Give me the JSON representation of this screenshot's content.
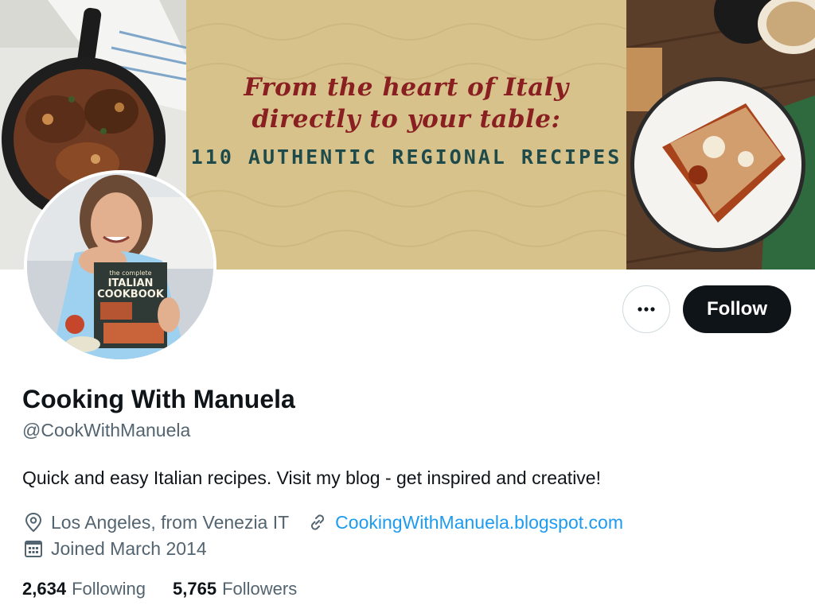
{
  "banner": {
    "line1": "From the heart of Italy",
    "line2": "directly to your table:",
    "line3": "110 AUTHENTIC REGIONAL RECIPES",
    "colors": {
      "script_text": "#8a1f22",
      "caps_text": "#1f4a4a",
      "parchment": "#d8c28c"
    }
  },
  "avatar": {
    "book_lines": [
      "the complete",
      "ITALIAN",
      "COOKBOOK"
    ]
  },
  "actions": {
    "more_icon": "more-horizontal-icon",
    "follow_label": "Follow"
  },
  "profile": {
    "display_name": "Cooking With Manuela",
    "handle": "@CookWithManuela",
    "bio": "Quick and easy Italian recipes. Visit my blog - get inspired and creative!",
    "location": "Los Angeles, from Venezia IT",
    "location_icon": "location-pin-icon",
    "website": "CookingWithManuela.blogspot.com",
    "website_icon": "link-icon",
    "joined": "Joined March 2014",
    "joined_icon": "calendar-icon"
  },
  "stats": {
    "following_count": "2,634",
    "following_label": "Following",
    "followers_count": "5,765",
    "followers_label": "Followers"
  },
  "colors": {
    "text_primary": "#0f1419",
    "text_secondary": "#536471",
    "link": "#1d9bf0",
    "follow_bg": "#0f1419"
  }
}
